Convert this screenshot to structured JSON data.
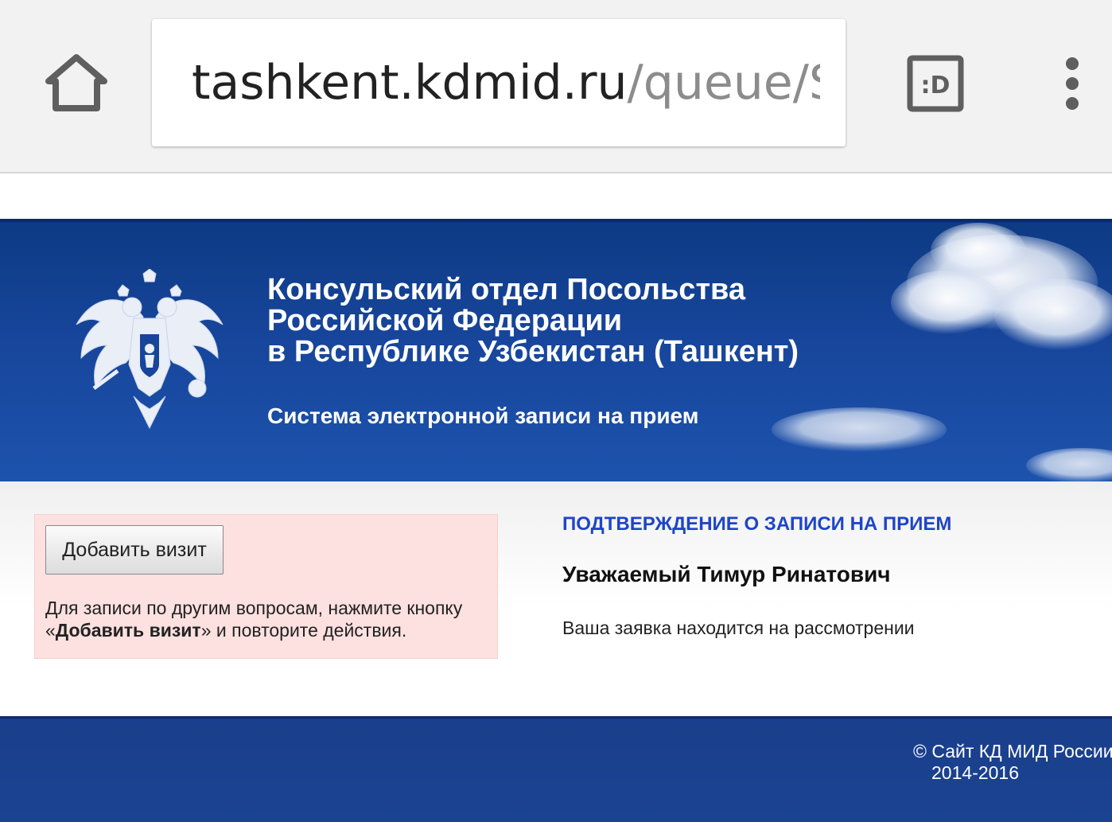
{
  "browser": {
    "url_host": "tashkent.kdmid.ru",
    "url_path": "/queue/SPQ",
    "tab_icon_label": ":D"
  },
  "banner": {
    "title_line1": "Консульский отдел Посольства",
    "title_line2": "Российской Федерации",
    "title_line3": "в Республике Узбекистан (Ташкент)",
    "subtitle": "Система электронной записи на прием"
  },
  "sidebar": {
    "add_visit_button": "Добавить визит",
    "hint_part1": "Для записи по другим вопросам, нажмите кнопку «",
    "hint_bold": "Добавить визит",
    "hint_part2": "» и повторите действия."
  },
  "main": {
    "heading": "ПОДТВЕРЖДЕНИЕ О ЗАПИСИ НА ПРИЕМ",
    "greeting": "Уважаемый Тимур Ринатович",
    "status": "Ваша заявка находится на рассмотрении"
  },
  "footer": {
    "copyright": "© Сайт КД МИД России",
    "years": "2014-2016"
  },
  "colors": {
    "banner_blue": "#17459b",
    "heading_blue": "#1e45c8",
    "pink_box": "#fde0e0",
    "footer_blue": "#1a4391"
  },
  "icons": [
    "home-icon",
    "tab-switcher-icon",
    "overflow-menu-icon",
    "coat-of-arms-emblem"
  ]
}
